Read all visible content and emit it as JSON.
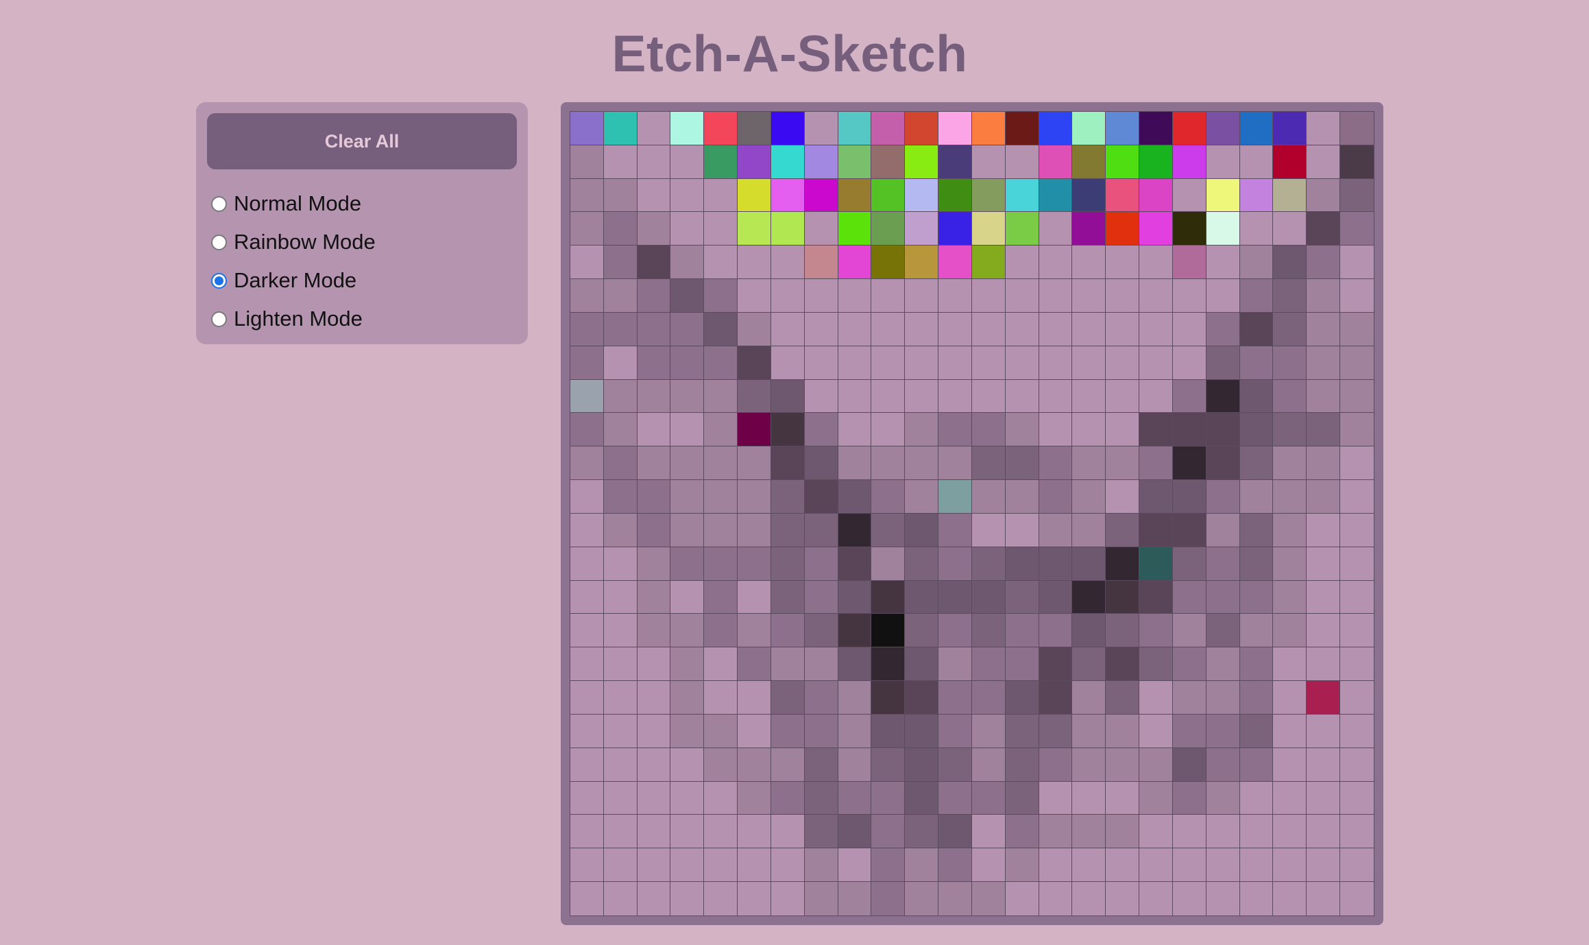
{
  "app": {
    "title": "Etch-A-Sketch"
  },
  "controls": {
    "clear_label": "Clear All",
    "modes": [
      {
        "label": "Normal Mode",
        "selected": false
      },
      {
        "label": "Rainbow Mode",
        "selected": false
      },
      {
        "label": "Darker Mode",
        "selected": true
      },
      {
        "label": "Lighten Mode",
        "selected": false
      }
    ]
  },
  "colors": {
    "background": "#d4b4c4",
    "accent": "#765f7d",
    "panel": "#b594b0",
    "cell_default": "#b592b0",
    "radio_selected": "#1a73e8"
  },
  "grid": {
    "size": 24,
    "cells": [
      [
        "#8a6fcb",
        "#2ec1b2",
        "#b592b0",
        "#adf7e2",
        "#f3465b",
        "#6d6569",
        "#3a0bf2",
        "#b592b0",
        "#55c7c4",
        "#c45fab",
        "#d2452f",
        "#fba4e6",
        "#fb7e40",
        "#6c1a17",
        "#2c44f4",
        "#9ff0c1",
        "#5f88d5",
        "#3f0b59",
        "#e0282c",
        "#7a51a2",
        "#1f6ec3",
        "#4c2bb2",
        "#b592b0",
        "#8c6d87"
      ],
      [
        "#a0829d",
        "#b592b0",
        "#b592b0",
        "#b592b0",
        "#3a9b62",
        "#9147c8",
        "#36d9cf",
        "#a388e1",
        "#7abf6b",
        "#936d6b",
        "#88ec13",
        "#493c79",
        "#b592b0",
        "#b592b0",
        "#df50b7",
        "#837a31",
        "#4fde12",
        "#18b31e",
        "#cc3ceb",
        "#b592b0",
        "#b592b0",
        "#b1002b",
        "#b592b0",
        "#4b3b48"
      ],
      [
        "#a0829d",
        "#a0829d",
        "#b592b0",
        "#b592b0",
        "#b592b0",
        "#d6dc2c",
        "#e45ef0",
        "#cb08ce",
        "#977c30",
        "#54c224",
        "#b4b9f2",
        "#3f8e13",
        "#849c5e",
        "#48d4d8",
        "#208fa7",
        "#3d3d76",
        "#e9527c",
        "#db44c4",
        "#b592b0",
        "#eff77b",
        "#c282dd",
        "#b3b094",
        "#a0829d",
        "#7c637c"
      ],
      [
        "#a0829d",
        "#8d718c",
        "#a0829d",
        "#b592b0",
        "#b592b0",
        "#b8e754",
        "#b1e852",
        "#b592b0",
        "#5ae20a",
        "#6b9e50",
        "#c09ecd",
        "#3922e6",
        "#d8d48a",
        "#7acb46",
        "#b592b0",
        "#920e96",
        "#e0300d",
        "#e23fe0",
        "#2f2c0a",
        "#d8f8e8",
        "#b592b0",
        "#b592b0",
        "#594458",
        "#8d718c"
      ],
      [
        "#b592b0",
        "#8d718c",
        "#594458",
        "#a0829d",
        "#b592b0",
        "#b592b0",
        "#b592b0",
        "#c4878f",
        "#e345d4",
        "#777307",
        "#b8963b",
        "#e550c9",
        "#84aa1d",
        "#b592b0",
        "#b592b0",
        "#b592b0",
        "#b592b0",
        "#b592b0",
        "#b06b9b",
        "#b592b0",
        "#a0829d",
        "#6e5870",
        "#8d718c",
        "#b592b0"
      ],
      [
        "#a0829d",
        "#a0829d",
        "#8d718c",
        "#6e5870",
        "#8d718c",
        "#b592b0",
        "#b592b0",
        "#b592b0",
        "#b592b0",
        "#b592b0",
        "#b592b0",
        "#b592b0",
        "#b592b0",
        "#b592b0",
        "#b592b0",
        "#b592b0",
        "#b592b0",
        "#b592b0",
        "#b592b0",
        "#b592b0",
        "#8d718c",
        "#7c637c",
        "#a0829d",
        "#b592b0"
      ],
      [
        "#8d718c",
        "#8d718c",
        "#8d718c",
        "#8d718c",
        "#6e5870",
        "#a0829d",
        "#b592b0",
        "#b592b0",
        "#b592b0",
        "#b592b0",
        "#b592b0",
        "#b592b0",
        "#b592b0",
        "#b592b0",
        "#b592b0",
        "#b592b0",
        "#b592b0",
        "#b592b0",
        "#b592b0",
        "#8d718c",
        "#594458",
        "#7c637c",
        "#a0829d",
        "#a0829d"
      ],
      [
        "#8d718c",
        "#b592b0",
        "#8d718c",
        "#8d718c",
        "#8d718c",
        "#594458",
        "#b592b0",
        "#b592b0",
        "#b592b0",
        "#b592b0",
        "#b592b0",
        "#b592b0",
        "#b592b0",
        "#b592b0",
        "#b592b0",
        "#b592b0",
        "#b592b0",
        "#b592b0",
        "#b592b0",
        "#7c637c",
        "#8d718c",
        "#8d718c",
        "#a0829d",
        "#a0829d"
      ],
      [
        "#9aa2ae",
        "#a0829d",
        "#a0829d",
        "#a0829d",
        "#a0829d",
        "#7c637c",
        "#6e5870",
        "#b592b0",
        "#b592b0",
        "#b592b0",
        "#b592b0",
        "#b592b0",
        "#b592b0",
        "#b592b0",
        "#b592b0",
        "#b592b0",
        "#b592b0",
        "#b592b0",
        "#8d718c",
        "#332731",
        "#6e5870",
        "#8d718c",
        "#a0829d",
        "#a0829d"
      ],
      [
        "#8d718c",
        "#a0829d",
        "#b592b0",
        "#b592b0",
        "#a0829d",
        "#6e0048",
        "#443540",
        "#8d718c",
        "#b592b0",
        "#b592b0",
        "#a0829d",
        "#8d718c",
        "#8d718c",
        "#a0829d",
        "#b592b0",
        "#b592b0",
        "#b592b0",
        "#594458",
        "#594458",
        "#594458",
        "#6e5870",
        "#7c637c",
        "#7c637c",
        "#a0829d"
      ],
      [
        "#a0829d",
        "#8d718c",
        "#a0829d",
        "#a0829d",
        "#a0829d",
        "#a0829d",
        "#594458",
        "#6e5870",
        "#a0829d",
        "#a0829d",
        "#a0829d",
        "#a0829d",
        "#7c637c",
        "#7c637c",
        "#8d718c",
        "#a0829d",
        "#a0829d",
        "#8d718c",
        "#332731",
        "#594458",
        "#7c637c",
        "#a0829d",
        "#a0829d",
        "#b592b0"
      ],
      [
        "#b592b0",
        "#8d718c",
        "#8d718c",
        "#a0829d",
        "#a0829d",
        "#a0829d",
        "#7c637c",
        "#594458",
        "#6e5870",
        "#8d718c",
        "#a0829d",
        "#7e9f9f",
        "#a0829d",
        "#a0829d",
        "#8d718c",
        "#a0829d",
        "#b592b0",
        "#6e5870",
        "#6e5870",
        "#8d718c",
        "#a0829d",
        "#a0829d",
        "#a0829d",
        "#b592b0"
      ],
      [
        "#b592b0",
        "#a0829d",
        "#8d718c",
        "#a0829d",
        "#a0829d",
        "#a0829d",
        "#7c637c",
        "#7c637c",
        "#332731",
        "#7c637c",
        "#6e5870",
        "#8d718c",
        "#b592b0",
        "#b592b0",
        "#a0829d",
        "#a0829d",
        "#7c637c",
        "#594458",
        "#594458",
        "#a0829d",
        "#7c637c",
        "#a0829d",
        "#b592b0",
        "#b592b0"
      ],
      [
        "#b592b0",
        "#b592b0",
        "#a0829d",
        "#8d718c",
        "#8d718c",
        "#8d718c",
        "#7c637c",
        "#8d718c",
        "#594458",
        "#a0829d",
        "#7c637c",
        "#8d718c",
        "#7c637c",
        "#6e5870",
        "#6e5870",
        "#6e5870",
        "#332731",
        "#2c5b59",
        "#7c637c",
        "#8d718c",
        "#7c637c",
        "#a0829d",
        "#b592b0",
        "#b592b0"
      ],
      [
        "#b592b0",
        "#b592b0",
        "#a0829d",
        "#b592b0",
        "#8d718c",
        "#b592b0",
        "#7c637c",
        "#8d718c",
        "#6e5870",
        "#443540",
        "#6e5870",
        "#6e5870",
        "#6e5870",
        "#7c637c",
        "#6e5870",
        "#332731",
        "#443540",
        "#594458",
        "#8d718c",
        "#8d718c",
        "#8d718c",
        "#a0829d",
        "#b592b0",
        "#b592b0"
      ],
      [
        "#b592b0",
        "#b592b0",
        "#a0829d",
        "#a0829d",
        "#8d718c",
        "#a0829d",
        "#8d718c",
        "#7c637c",
        "#443540",
        "#111111",
        "#7c637c",
        "#8d718c",
        "#7c637c",
        "#8d718c",
        "#8d718c",
        "#6e5870",
        "#7c637c",
        "#8d718c",
        "#a0829d",
        "#7c637c",
        "#a0829d",
        "#a0829d",
        "#b592b0",
        "#b592b0"
      ],
      [
        "#b592b0",
        "#b592b0",
        "#b592b0",
        "#a0829d",
        "#b592b0",
        "#8d718c",
        "#a0829d",
        "#a0829d",
        "#6e5870",
        "#332731",
        "#6e5870",
        "#a0829d",
        "#8d718c",
        "#8d718c",
        "#594458",
        "#7c637c",
        "#594458",
        "#7c637c",
        "#8d718c",
        "#a0829d",
        "#8d718c",
        "#b592b0",
        "#b592b0",
        "#b592b0"
      ],
      [
        "#b592b0",
        "#b592b0",
        "#b592b0",
        "#a0829d",
        "#b592b0",
        "#b592b0",
        "#7c637c",
        "#8d718c",
        "#a0829d",
        "#443540",
        "#594458",
        "#8d718c",
        "#8d718c",
        "#6e5870",
        "#594458",
        "#a0829d",
        "#7c637c",
        "#b592b0",
        "#a0829d",
        "#a0829d",
        "#8d718c",
        "#b592b0",
        "#a81f50",
        "#b592b0"
      ],
      [
        "#b592b0",
        "#b592b0",
        "#b592b0",
        "#a0829d",
        "#a0829d",
        "#b592b0",
        "#8d718c",
        "#8d718c",
        "#a0829d",
        "#6e5870",
        "#6e5870",
        "#8d718c",
        "#a0829d",
        "#7c637c",
        "#7c637c",
        "#a0829d",
        "#a0829d",
        "#b592b0",
        "#8d718c",
        "#8d718c",
        "#7c637c",
        "#b592b0",
        "#b592b0",
        "#b592b0"
      ],
      [
        "#b592b0",
        "#b592b0",
        "#b592b0",
        "#b592b0",
        "#a0829d",
        "#a0829d",
        "#a0829d",
        "#7c637c",
        "#a0829d",
        "#7c637c",
        "#6e5870",
        "#7c637c",
        "#a0829d",
        "#7c637c",
        "#8d718c",
        "#a0829d",
        "#a0829d",
        "#a0829d",
        "#6e5870",
        "#8d718c",
        "#8d718c",
        "#b592b0",
        "#b592b0",
        "#b592b0"
      ],
      [
        "#b592b0",
        "#b592b0",
        "#b592b0",
        "#b592b0",
        "#b592b0",
        "#a0829d",
        "#8d718c",
        "#7c637c",
        "#8d718c",
        "#8d718c",
        "#6e5870",
        "#8d718c",
        "#8d718c",
        "#7c637c",
        "#b592b0",
        "#b592b0",
        "#b592b0",
        "#a0829d",
        "#8d718c",
        "#a0829d",
        "#b592b0",
        "#b592b0",
        "#b592b0",
        "#b592b0"
      ],
      [
        "#b592b0",
        "#b592b0",
        "#b592b0",
        "#b592b0",
        "#b592b0",
        "#b592b0",
        "#b592b0",
        "#7c637c",
        "#6e5870",
        "#8d718c",
        "#7c637c",
        "#6e5870",
        "#b592b0",
        "#8d718c",
        "#a0829d",
        "#a0829d",
        "#a0829d",
        "#b592b0",
        "#b592b0",
        "#b592b0",
        "#b592b0",
        "#b592b0",
        "#b592b0",
        "#b592b0"
      ],
      [
        "#b592b0",
        "#b592b0",
        "#b592b0",
        "#b592b0",
        "#b592b0",
        "#b592b0",
        "#b592b0",
        "#a0829d",
        "#b592b0",
        "#8d718c",
        "#a0829d",
        "#8d718c",
        "#b592b0",
        "#a0829d",
        "#b592b0",
        "#b592b0",
        "#b592b0",
        "#b592b0",
        "#b592b0",
        "#b592b0",
        "#b592b0",
        "#b592b0",
        "#b592b0",
        "#b592b0"
      ],
      [
        "#b592b0",
        "#b592b0",
        "#b592b0",
        "#b592b0",
        "#b592b0",
        "#b592b0",
        "#b592b0",
        "#a0829d",
        "#a0829d",
        "#8d718c",
        "#a0829d",
        "#a0829d",
        "#a0829d",
        "#b592b0",
        "#b592b0",
        "#b592b0",
        "#b592b0",
        "#b592b0",
        "#b592b0",
        "#b592b0",
        "#b592b0",
        "#b592b0",
        "#b592b0",
        "#b592b0"
      ]
    ]
  }
}
